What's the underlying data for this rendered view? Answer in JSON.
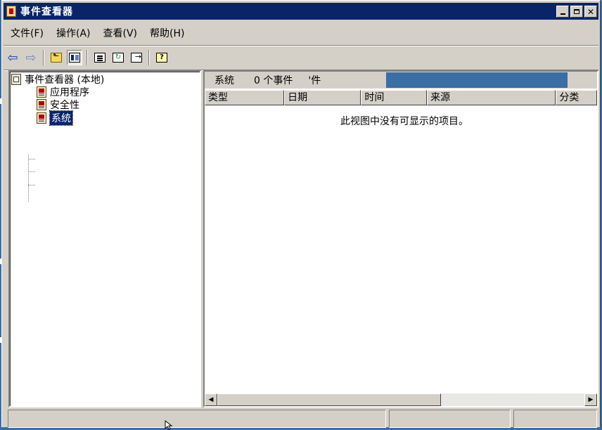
{
  "window": {
    "title": "事件查看器",
    "controls": [
      "minimize",
      "maximize",
      "close"
    ]
  },
  "menu": [
    "文件(F)",
    "操作(A)",
    "查看(V)",
    "帮助(H)"
  ],
  "toolbar": {
    "buttons": [
      {
        "icon": "back-arrow-icon",
        "glyph": "⇦"
      },
      {
        "icon": "forward-arrow-icon",
        "glyph": "⇨"
      },
      {
        "icon": "up-one-level-icon"
      },
      {
        "icon": "show-hide-tree-icon"
      },
      {
        "icon": "properties-icon"
      },
      {
        "icon": "refresh-icon",
        "glyph": "↻"
      },
      {
        "icon": "export-list-icon"
      },
      {
        "icon": "help-icon",
        "glyph": "?"
      }
    ]
  },
  "tree": {
    "root": "事件查看器 (本地)",
    "items": [
      "应用程序",
      "安全性",
      "系统"
    ],
    "selected": "系统"
  },
  "summary": {
    "log_name": "系统",
    "count_text": "0 个事件",
    "extra": "'件"
  },
  "columns": [
    "类型",
    "日期",
    "时间",
    "来源",
    "分类"
  ],
  "empty_message": "此视图中没有可显示的项目。",
  "scrollbar": {
    "left_arrow": "◀",
    "right_arrow": "▶"
  },
  "colors": {
    "title_bar": "#0a246a",
    "face": "#d4d0c8",
    "desktop": "#3a6ea5",
    "selection": "#0a246a"
  }
}
